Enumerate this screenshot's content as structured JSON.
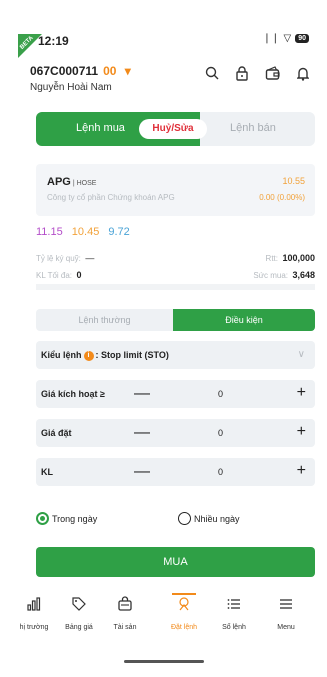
{
  "status_bar": {
    "time": "12:19",
    "beta_tag": "BETA",
    "signal": "❘❘",
    "wifi": "▽",
    "battery": "90"
  },
  "account": {
    "number": "067C000711",
    "sub_account": "00",
    "caret": "▾",
    "name": "Nguyễn Hoài Nam"
  },
  "header_icons": [
    "search-icon",
    "lock-icon",
    "wallet-icon",
    "bell-icon"
  ],
  "order_tabs": {
    "buy": "Lệnh mua",
    "cancel": "Huỷ/Sửa",
    "sell": "Lệnh bán"
  },
  "stock": {
    "symbol": "APG",
    "exchange": "| HOSE",
    "company": "Công ty cổ phần Chứng khoán APG",
    "price": "10.55",
    "change": "0.00 (0.00%)"
  },
  "prices": {
    "ceiling": "11.15",
    "reference": "10.45",
    "floor": "9.72"
  },
  "info": {
    "margin_ratio_label": "Tỷ lệ ký quỹ:",
    "margin_ratio_value": "—",
    "max_qty_label": "KL Tối đa:",
    "max_qty_value": "0",
    "rtt_label": "Rtt:",
    "rtt_value": "100,000",
    "buying_power_label": "Sức mua:",
    "buying_power_value": "3,648"
  },
  "order_type_toggle": {
    "normal": "Lệnh thường",
    "conditional": "Điều kiện"
  },
  "form": {
    "order_kind_label": "Kiểu lệnh",
    "info_icon": "i",
    "order_kind_value": ": Stop limit (STO)",
    "chevron": "∨",
    "trigger_label": "Giá kích hoạt ≥",
    "trigger_value": "0",
    "price_label": "Giá đặt",
    "price_value": "0",
    "qty_label": "KL",
    "qty_value": "0",
    "minus": "—",
    "plus": "+"
  },
  "validity": {
    "in_day": "Trong ngày",
    "multi_day": "Nhiều ngày",
    "selected": "in_day"
  },
  "submit": {
    "label": "MUA"
  },
  "bottom_nav": [
    {
      "label": "hị trường",
      "icon": "chart-icon",
      "glyph": "▐▙"
    },
    {
      "label": "Bảng giá",
      "icon": "tag-icon",
      "glyph": "♡"
    },
    {
      "label": "Tài sản",
      "icon": "bag-icon",
      "glyph": "☗"
    },
    {
      "label": "Đặt lệnh",
      "icon": "place-order-icon",
      "glyph": "☆"
    },
    {
      "label": "Sổ lệnh",
      "icon": "order-book-icon",
      "glyph": "≣"
    },
    {
      "label": "Menu",
      "icon": "menu-icon",
      "glyph": "≡"
    }
  ],
  "colors": {
    "primary_green": "#2fa046",
    "accent_orange": "#f28a1a",
    "danger_red": "#e0303a",
    "ceiling_purple": "#b44ec9",
    "floor_blue": "#4aa3d6",
    "reference_yellow": "#f2a23a"
  }
}
